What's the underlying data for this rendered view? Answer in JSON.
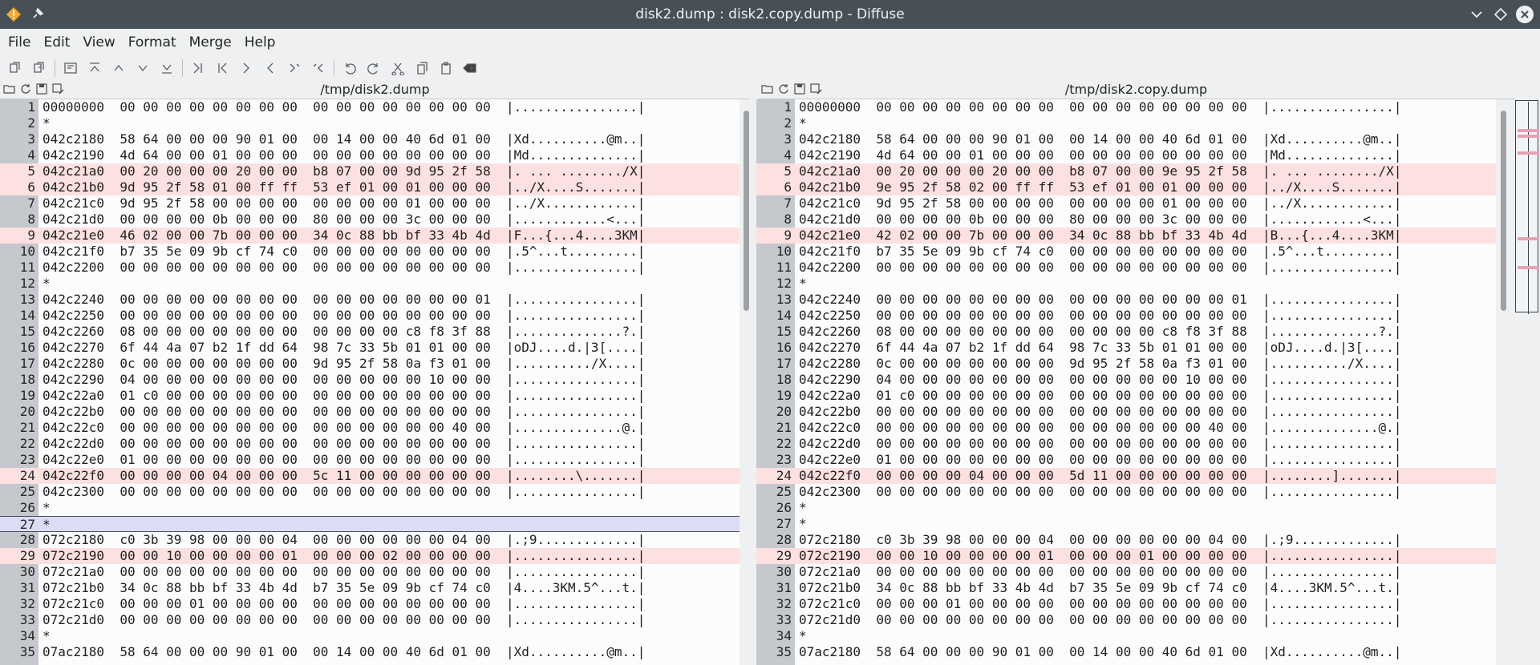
{
  "window": {
    "title": "disk2.dump : disk2.copy.dump - Diffuse",
    "app_icon": "diffuse-app-icon",
    "pin_icon": "pin-icon"
  },
  "menu": [
    "File",
    "Edit",
    "View",
    "Format",
    "Merge",
    "Help"
  ],
  "toolbar_icons": [
    "copy-left-icon",
    "copy-right-icon",
    "|",
    "realign-icon",
    "first-diff-icon",
    "previous-diff-icon",
    "next-diff-icon",
    "last-diff-icon",
    "|",
    "goto-end-icon",
    "goto-start-icon",
    "next-icon",
    "previous-icon",
    "merge-left-icon",
    "merge-right-icon",
    "|",
    "undo-icon",
    "redo-icon",
    "cut-icon",
    "copy-icon",
    "paste-icon",
    "clear-icon"
  ],
  "colors": {
    "titlebar": "#475057",
    "diff_row": "#fde0e0",
    "cursor_row": "#dcdcf5",
    "gutter": "#c5c8cc",
    "overview_mark": "#e9a0b2"
  },
  "left": {
    "path": "/tmp/disk2.dump",
    "lines": [
      {
        "n": "1",
        "t": "00000000  00 00 00 00 00 00 00 00  00 00 00 00 00 00 00 00  |................|"
      },
      {
        "n": "2",
        "t": "*"
      },
      {
        "n": "3",
        "t": "042c2180  58 64 00 00 00 90 01 00  00 14 00 00 40 6d 01 00  |Xd..........@m..|"
      },
      {
        "n": "4",
        "t": "042c2190  4d 64 00 00 01 00 00 00  00 00 00 00 00 00 00 00  |Md..............|"
      },
      {
        "n": "5",
        "t": "042c21a0  00 20 00 00 00 20 00 00  b8 07 00 00 9d 95 2f 58  |. ... ......../X|",
        "d": true
      },
      {
        "n": "6",
        "t": "042c21b0  9d 95 2f 58 01 00 ff ff  53 ef 01 00 01 00 00 00  |../X....S.......|",
        "d": true
      },
      {
        "n": "7",
        "t": "042c21c0  9d 95 2f 58 00 00 00 00  00 00 00 00 01 00 00 00  |../X............|"
      },
      {
        "n": "8",
        "t": "042c21d0  00 00 00 00 0b 00 00 00  80 00 00 00 3c 00 00 00  |............<...|"
      },
      {
        "n": "9",
        "t": "042c21e0  46 02 00 00 7b 00 00 00  34 0c 88 bb bf 33 4b 4d  |F...{...4....3KM|",
        "d": true
      },
      {
        "n": "10",
        "t": "042c21f0  b7 35 5e 09 9b cf 74 c0  00 00 00 00 00 00 00 00  |.5^...t.........|"
      },
      {
        "n": "11",
        "t": "042c2200  00 00 00 00 00 00 00 00  00 00 00 00 00 00 00 00  |................|"
      },
      {
        "n": "12",
        "t": "*"
      },
      {
        "n": "13",
        "t": "042c2240  00 00 00 00 00 00 00 00  00 00 00 00 00 00 00 01  |................|"
      },
      {
        "n": "14",
        "t": "042c2250  00 00 00 00 00 00 00 00  00 00 00 00 00 00 00 00  |................|"
      },
      {
        "n": "15",
        "t": "042c2260  08 00 00 00 00 00 00 00  00 00 00 00 c8 f8 3f 88  |..............?.|"
      },
      {
        "n": "16",
        "t": "042c2270  6f 44 4a 07 b2 1f dd 64  98 7c 33 5b 01 01 00 00  |oDJ....d.|3[....|"
      },
      {
        "n": "17",
        "t": "042c2280  0c 00 00 00 00 00 00 00  9d 95 2f 58 0a f3 01 00  |........../X....|"
      },
      {
        "n": "18",
        "t": "042c2290  04 00 00 00 00 00 00 00  00 00 00 00 00 10 00 00  |................|"
      },
      {
        "n": "19",
        "t": "042c22a0  01 c0 00 00 00 00 00 00  00 00 00 00 00 00 00 00  |................|"
      },
      {
        "n": "20",
        "t": "042c22b0  00 00 00 00 00 00 00 00  00 00 00 00 00 00 00 00  |................|"
      },
      {
        "n": "21",
        "t": "042c22c0  00 00 00 00 00 00 00 00  00 00 00 00 00 00 40 00  |..............@.|"
      },
      {
        "n": "22",
        "t": "042c22d0  00 00 00 00 00 00 00 00  00 00 00 00 00 00 00 00  |................|"
      },
      {
        "n": "23",
        "t": "042c22e0  01 00 00 00 00 00 00 00  00 00 00 00 00 00 00 00  |................|"
      },
      {
        "n": "24",
        "t": "042c22f0  00 00 00 00 04 00 00 00  5c 11 00 00 00 00 00 00  |........\\.......|",
        "d": true
      },
      {
        "n": "25",
        "t": "042c2300  00 00 00 00 00 00 00 00  00 00 00 00 00 00 00 00  |................|"
      },
      {
        "n": "26",
        "t": "*"
      },
      {
        "n": "27",
        "t": "*",
        "c": true
      },
      {
        "n": "28",
        "t": "072c2180  c0 3b 39 98 00 00 00 04  00 00 00 00 00 00 04 00  |.;9.............|"
      },
      {
        "n": "29",
        "t": "072c2190  00 00 10 00 00 00 00 01  00 00 00 02 00 00 00 00  |................|",
        "d": true
      },
      {
        "n": "30",
        "t": "072c21a0  00 00 00 00 00 00 00 00  00 00 00 00 00 00 00 00  |................|"
      },
      {
        "n": "31",
        "t": "072c21b0  34 0c 88 bb bf 33 4b 4d  b7 35 5e 09 9b cf 74 c0  |4....3KM.5^...t.|"
      },
      {
        "n": "32",
        "t": "072c21c0  00 00 00 01 00 00 00 00  00 00 00 00 00 00 00 00  |................|"
      },
      {
        "n": "33",
        "t": "072c21d0  00 00 00 00 00 00 00 00  00 00 00 00 00 00 00 00  |................|"
      },
      {
        "n": "34",
        "t": "*"
      },
      {
        "n": "35",
        "t": "07ac2180  58 64 00 00 00 90 01 00  00 14 00 00 40 6d 01 00  |Xd..........@m..|"
      }
    ]
  },
  "right": {
    "path": "/tmp/disk2.copy.dump",
    "lines": [
      {
        "n": "1",
        "t": "00000000  00 00 00 00 00 00 00 00  00 00 00 00 00 00 00 00  |................|"
      },
      {
        "n": "2",
        "t": "*"
      },
      {
        "n": "3",
        "t": "042c2180  58 64 00 00 00 90 01 00  00 14 00 00 40 6d 01 00  |Xd..........@m..|"
      },
      {
        "n": "4",
        "t": "042c2190  4d 64 00 00 01 00 00 00  00 00 00 00 00 00 00 00  |Md..............|"
      },
      {
        "n": "5",
        "t": "042c21a0  00 20 00 00 00 20 00 00  b8 07 00 00 9e 95 2f 58  |. ... ......../X|",
        "d": true
      },
      {
        "n": "6",
        "t": "042c21b0  9e 95 2f 58 02 00 ff ff  53 ef 01 00 01 00 00 00  |../X....S.......|",
        "d": true
      },
      {
        "n": "7",
        "t": "042c21c0  9d 95 2f 58 00 00 00 00  00 00 00 00 01 00 00 00  |../X............|"
      },
      {
        "n": "8",
        "t": "042c21d0  00 00 00 00 0b 00 00 00  80 00 00 00 3c 00 00 00  |............<...|"
      },
      {
        "n": "9",
        "t": "042c21e0  42 02 00 00 7b 00 00 00  34 0c 88 bb bf 33 4b 4d  |B...{...4....3KM|",
        "d": true
      },
      {
        "n": "10",
        "t": "042c21f0  b7 35 5e 09 9b cf 74 c0  00 00 00 00 00 00 00 00  |.5^...t.........|"
      },
      {
        "n": "11",
        "t": "042c2200  00 00 00 00 00 00 00 00  00 00 00 00 00 00 00 00  |................|"
      },
      {
        "n": "12",
        "t": "*"
      },
      {
        "n": "13",
        "t": "042c2240  00 00 00 00 00 00 00 00  00 00 00 00 00 00 00 01  |................|"
      },
      {
        "n": "14",
        "t": "042c2250  00 00 00 00 00 00 00 00  00 00 00 00 00 00 00 00  |................|"
      },
      {
        "n": "15",
        "t": "042c2260  08 00 00 00 00 00 00 00  00 00 00 00 c8 f8 3f 88  |..............?.|"
      },
      {
        "n": "16",
        "t": "042c2270  6f 44 4a 07 b2 1f dd 64  98 7c 33 5b 01 01 00 00  |oDJ....d.|3[....|"
      },
      {
        "n": "17",
        "t": "042c2280  0c 00 00 00 00 00 00 00  9d 95 2f 58 0a f3 01 00  |........../X....|"
      },
      {
        "n": "18",
        "t": "042c2290  04 00 00 00 00 00 00 00  00 00 00 00 00 10 00 00  |................|"
      },
      {
        "n": "19",
        "t": "042c22a0  01 c0 00 00 00 00 00 00  00 00 00 00 00 00 00 00  |................|"
      },
      {
        "n": "20",
        "t": "042c22b0  00 00 00 00 00 00 00 00  00 00 00 00 00 00 00 00  |................|"
      },
      {
        "n": "21",
        "t": "042c22c0  00 00 00 00 00 00 00 00  00 00 00 00 00 00 40 00  |..............@.|"
      },
      {
        "n": "22",
        "t": "042c22d0  00 00 00 00 00 00 00 00  00 00 00 00 00 00 00 00  |................|"
      },
      {
        "n": "23",
        "t": "042c22e0  01 00 00 00 00 00 00 00  00 00 00 00 00 00 00 00  |................|"
      },
      {
        "n": "24",
        "t": "042c22f0  00 00 00 00 04 00 00 00  5d 11 00 00 00 00 00 00  |........].......|",
        "d": true
      },
      {
        "n": "25",
        "t": "042c2300  00 00 00 00 00 00 00 00  00 00 00 00 00 00 00 00  |................|"
      },
      {
        "n": "26",
        "t": "*"
      },
      {
        "n": "27",
        "t": "*"
      },
      {
        "n": "28",
        "t": "072c2180  c0 3b 39 98 00 00 00 04  00 00 00 00 00 00 04 00  |.;9.............|"
      },
      {
        "n": "29",
        "t": "072c2190  00 00 10 00 00 00 00 01  00 00 00 01 00 00 00 00  |................|",
        "d": true
      },
      {
        "n": "30",
        "t": "072c21a0  00 00 00 00 00 00 00 00  00 00 00 00 00 00 00 00  |................|"
      },
      {
        "n": "31",
        "t": "072c21b0  34 0c 88 bb bf 33 4b 4d  b7 35 5e 09 9b cf 74 c0  |4....3KM.5^...t.|"
      },
      {
        "n": "32",
        "t": "072c21c0  00 00 00 01 00 00 00 00  00 00 00 00 00 00 00 00  |................|"
      },
      {
        "n": "33",
        "t": "072c21d0  00 00 00 00 00 00 00 00  00 00 00 00 00 00 00 00  |................|"
      },
      {
        "n": "34",
        "t": "*"
      },
      {
        "n": "35",
        "t": "07ac2180  58 64 00 00 00 90 01 00  00 14 00 00 40 6d 01 00  |Xd..........@m..|"
      }
    ]
  },
  "overview_marks": [
    5,
    6,
    9,
    24,
    29
  ]
}
